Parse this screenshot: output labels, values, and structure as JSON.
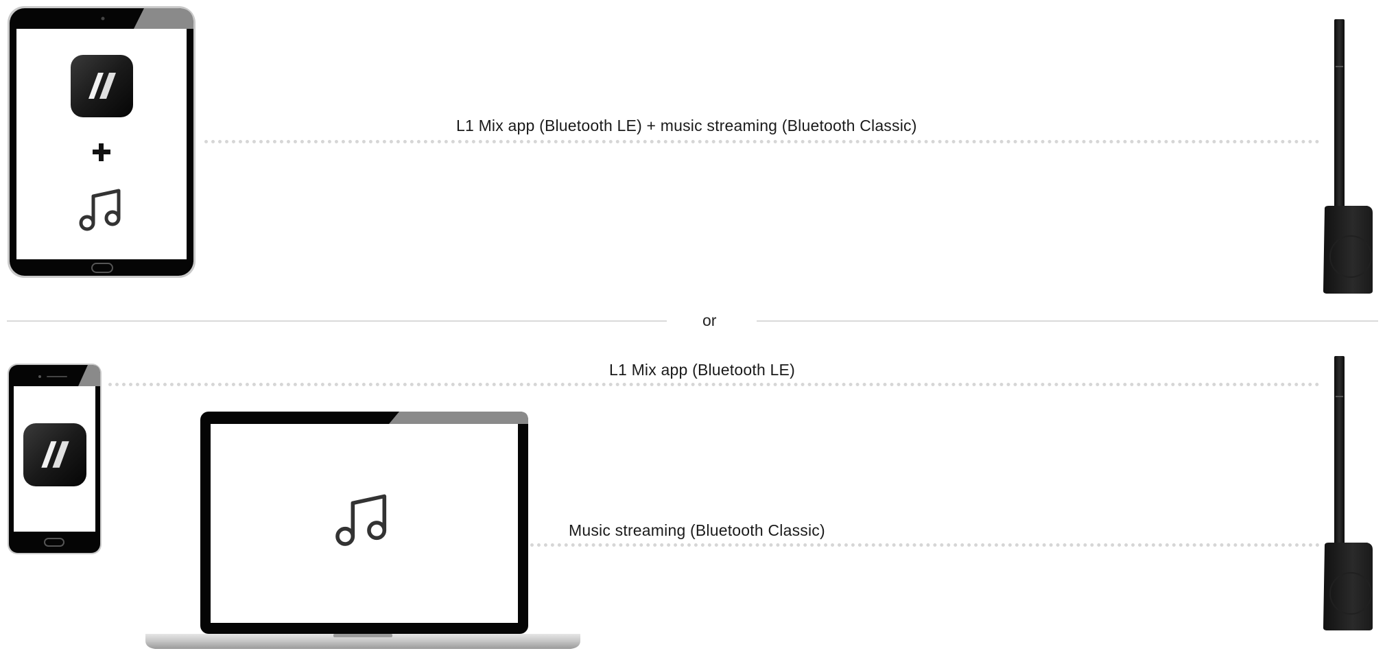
{
  "top": {
    "connection_label": "L1 Mix app (Bluetooth LE) + music streaming (Bluetooth Classic)",
    "plus_symbol": "+"
  },
  "separator": {
    "text": "or"
  },
  "bottom": {
    "app_connection_label": "L1 Mix app (Bluetooth LE)",
    "music_connection_label": "Music streaming (Bluetooth Classic)"
  },
  "icons": {
    "app": "l1-mix-app-icon",
    "music": "music-note-icon",
    "speaker": "column-speaker"
  },
  "colors": {
    "dots": "#d6d6d6",
    "rule": "#d9d9d9",
    "device_frame": "#000000"
  }
}
